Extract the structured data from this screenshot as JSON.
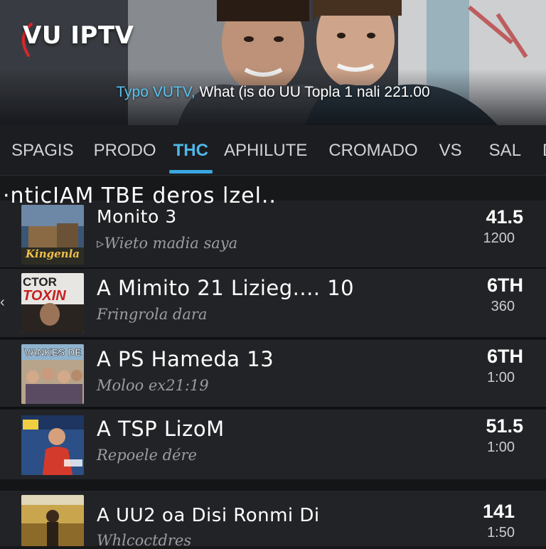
{
  "app": {
    "title": "VU IPTV"
  },
  "hero": {
    "caption_accent": "Typo VUTV,",
    "caption_rest": " What (is do UU Topla 1 nali 221.00"
  },
  "tabs": [
    {
      "label": "SPAGIS",
      "active": false
    },
    {
      "label": "PRODO",
      "active": false
    },
    {
      "label": "THC",
      "active": true
    },
    {
      "label": "APHILUTE",
      "active": false
    },
    {
      "label": "CROMADO",
      "active": false
    },
    {
      "label": "VS",
      "active": false
    },
    {
      "label": "SAL",
      "active": false
    },
    {
      "label": "DU",
      "active": false
    }
  ],
  "list_header": "·nticIAM TBE deros lzel..",
  "items": [
    {
      "title": "Monito 3",
      "subtitle": "▹Wieto madia saya",
      "value": "41.5",
      "value2": "1200",
      "thumb_text": "Kingenla"
    },
    {
      "title": "A Mimito 21 Lizieg.... 10",
      "subtitle": "Fringrola dara",
      "value": "6TH",
      "value2": "360",
      "thumb_text": "CTOR TOXIN"
    },
    {
      "title": "A PS Hameda 13",
      "subtitle": "Moloo ex21:19",
      "value": "6TH",
      "value2": "1:00",
      "thumb_text": "VANKES DE"
    },
    {
      "title": "A TSP LizoM",
      "subtitle": "Repoele dére",
      "value": "51.5",
      "value2": "1:00",
      "thumb_text": ""
    },
    {
      "title": "A UU2 oa Disi Ronmi Di",
      "subtitle": "Whlcoctdres",
      "value": "141",
      "value2": "1:50",
      "thumb_text": ""
    }
  ],
  "colors": {
    "accent": "#4fb8ea",
    "background": "#17181a",
    "row": "#222326"
  }
}
